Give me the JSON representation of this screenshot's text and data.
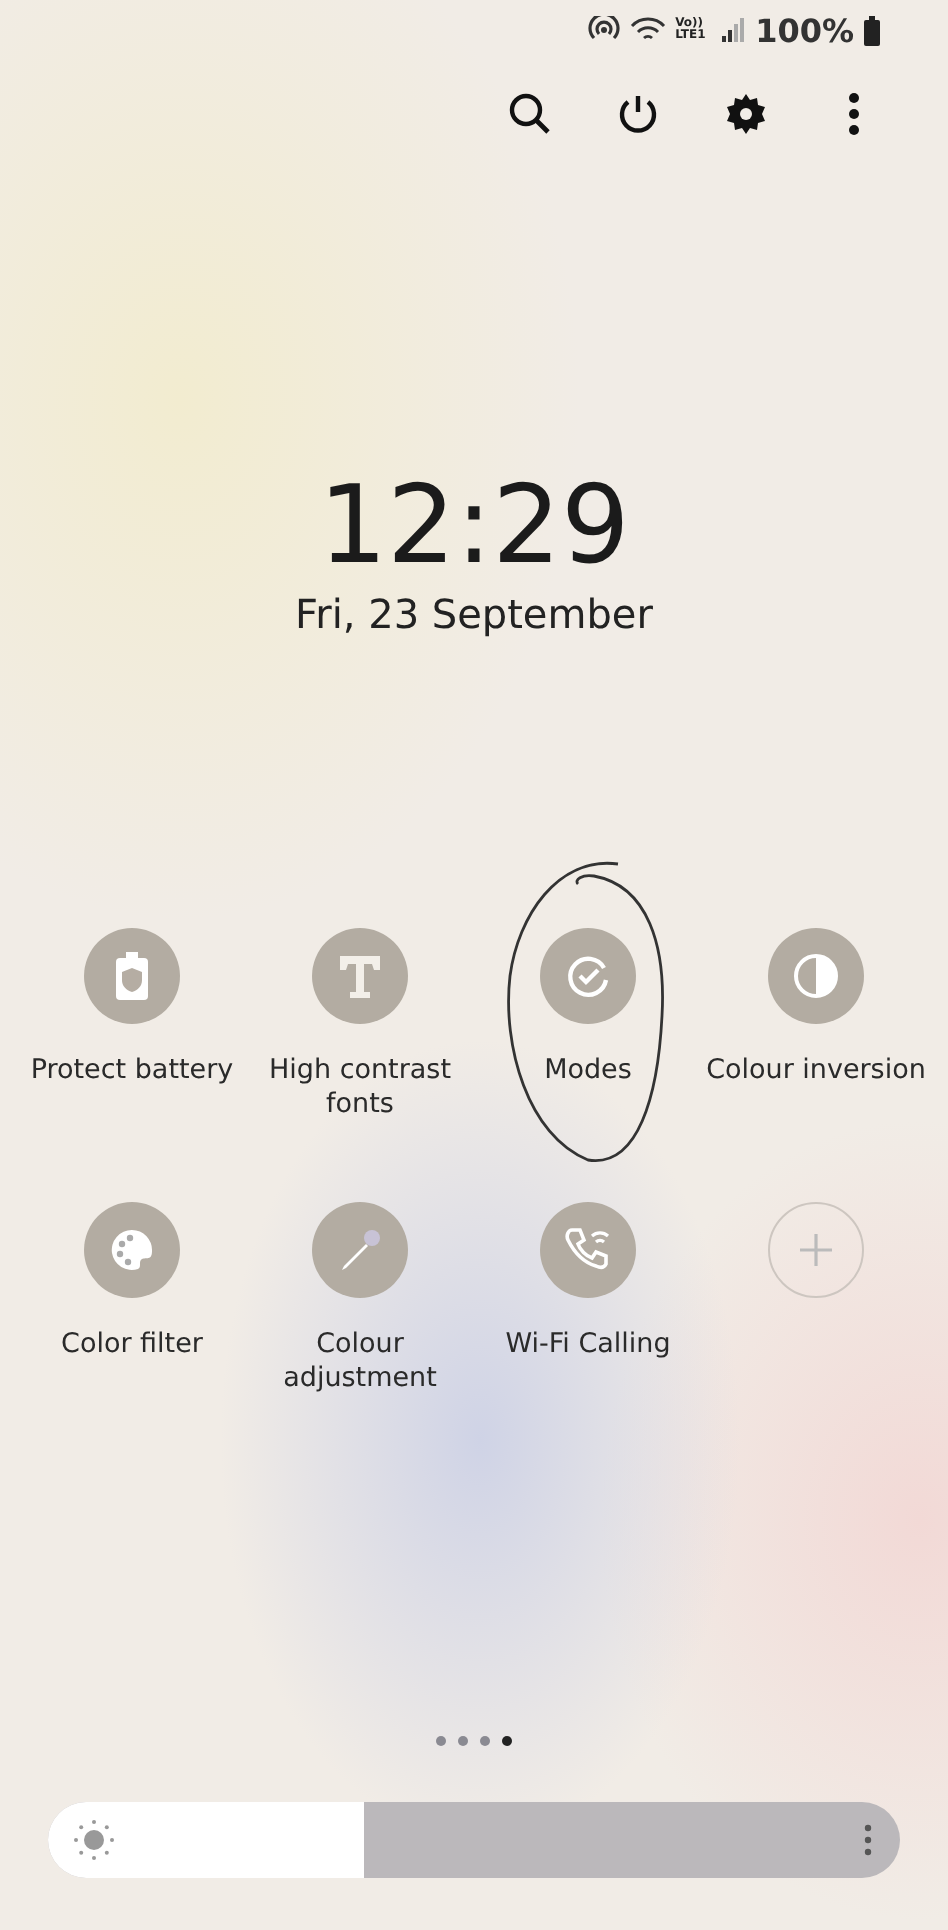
{
  "status_bar": {
    "network_label": "Vo)) LTE1",
    "battery": "100%"
  },
  "header_actions": [
    {
      "kind": "search"
    },
    {
      "kind": "power"
    },
    {
      "kind": "settings"
    },
    {
      "kind": "more"
    }
  ],
  "clock": {
    "time": "12:29",
    "date": "Fri, 23 September"
  },
  "tiles": [
    {
      "kind": "battery",
      "label": "Protect battery",
      "circled": false
    },
    {
      "kind": "text",
      "label": "High contrast fonts",
      "circled": false
    },
    {
      "kind": "modes",
      "label": "Modes",
      "circled": true
    },
    {
      "kind": "inversion",
      "label": "Colour inversion",
      "circled": false
    },
    {
      "kind": "palette",
      "label": "Color filter",
      "circled": false
    },
    {
      "kind": "dropper",
      "label": "Colour adjustment",
      "circled": false
    },
    {
      "kind": "wifi_call",
      "label": "Wi-Fi Calling",
      "circled": false
    },
    {
      "kind": "add",
      "circled": false
    }
  ],
  "page_dots": [
    {
      "selected": false
    },
    {
      "selected": false
    },
    {
      "selected": false
    },
    {
      "selected": true
    }
  ],
  "brightness": {
    "level": 0.37
  }
}
